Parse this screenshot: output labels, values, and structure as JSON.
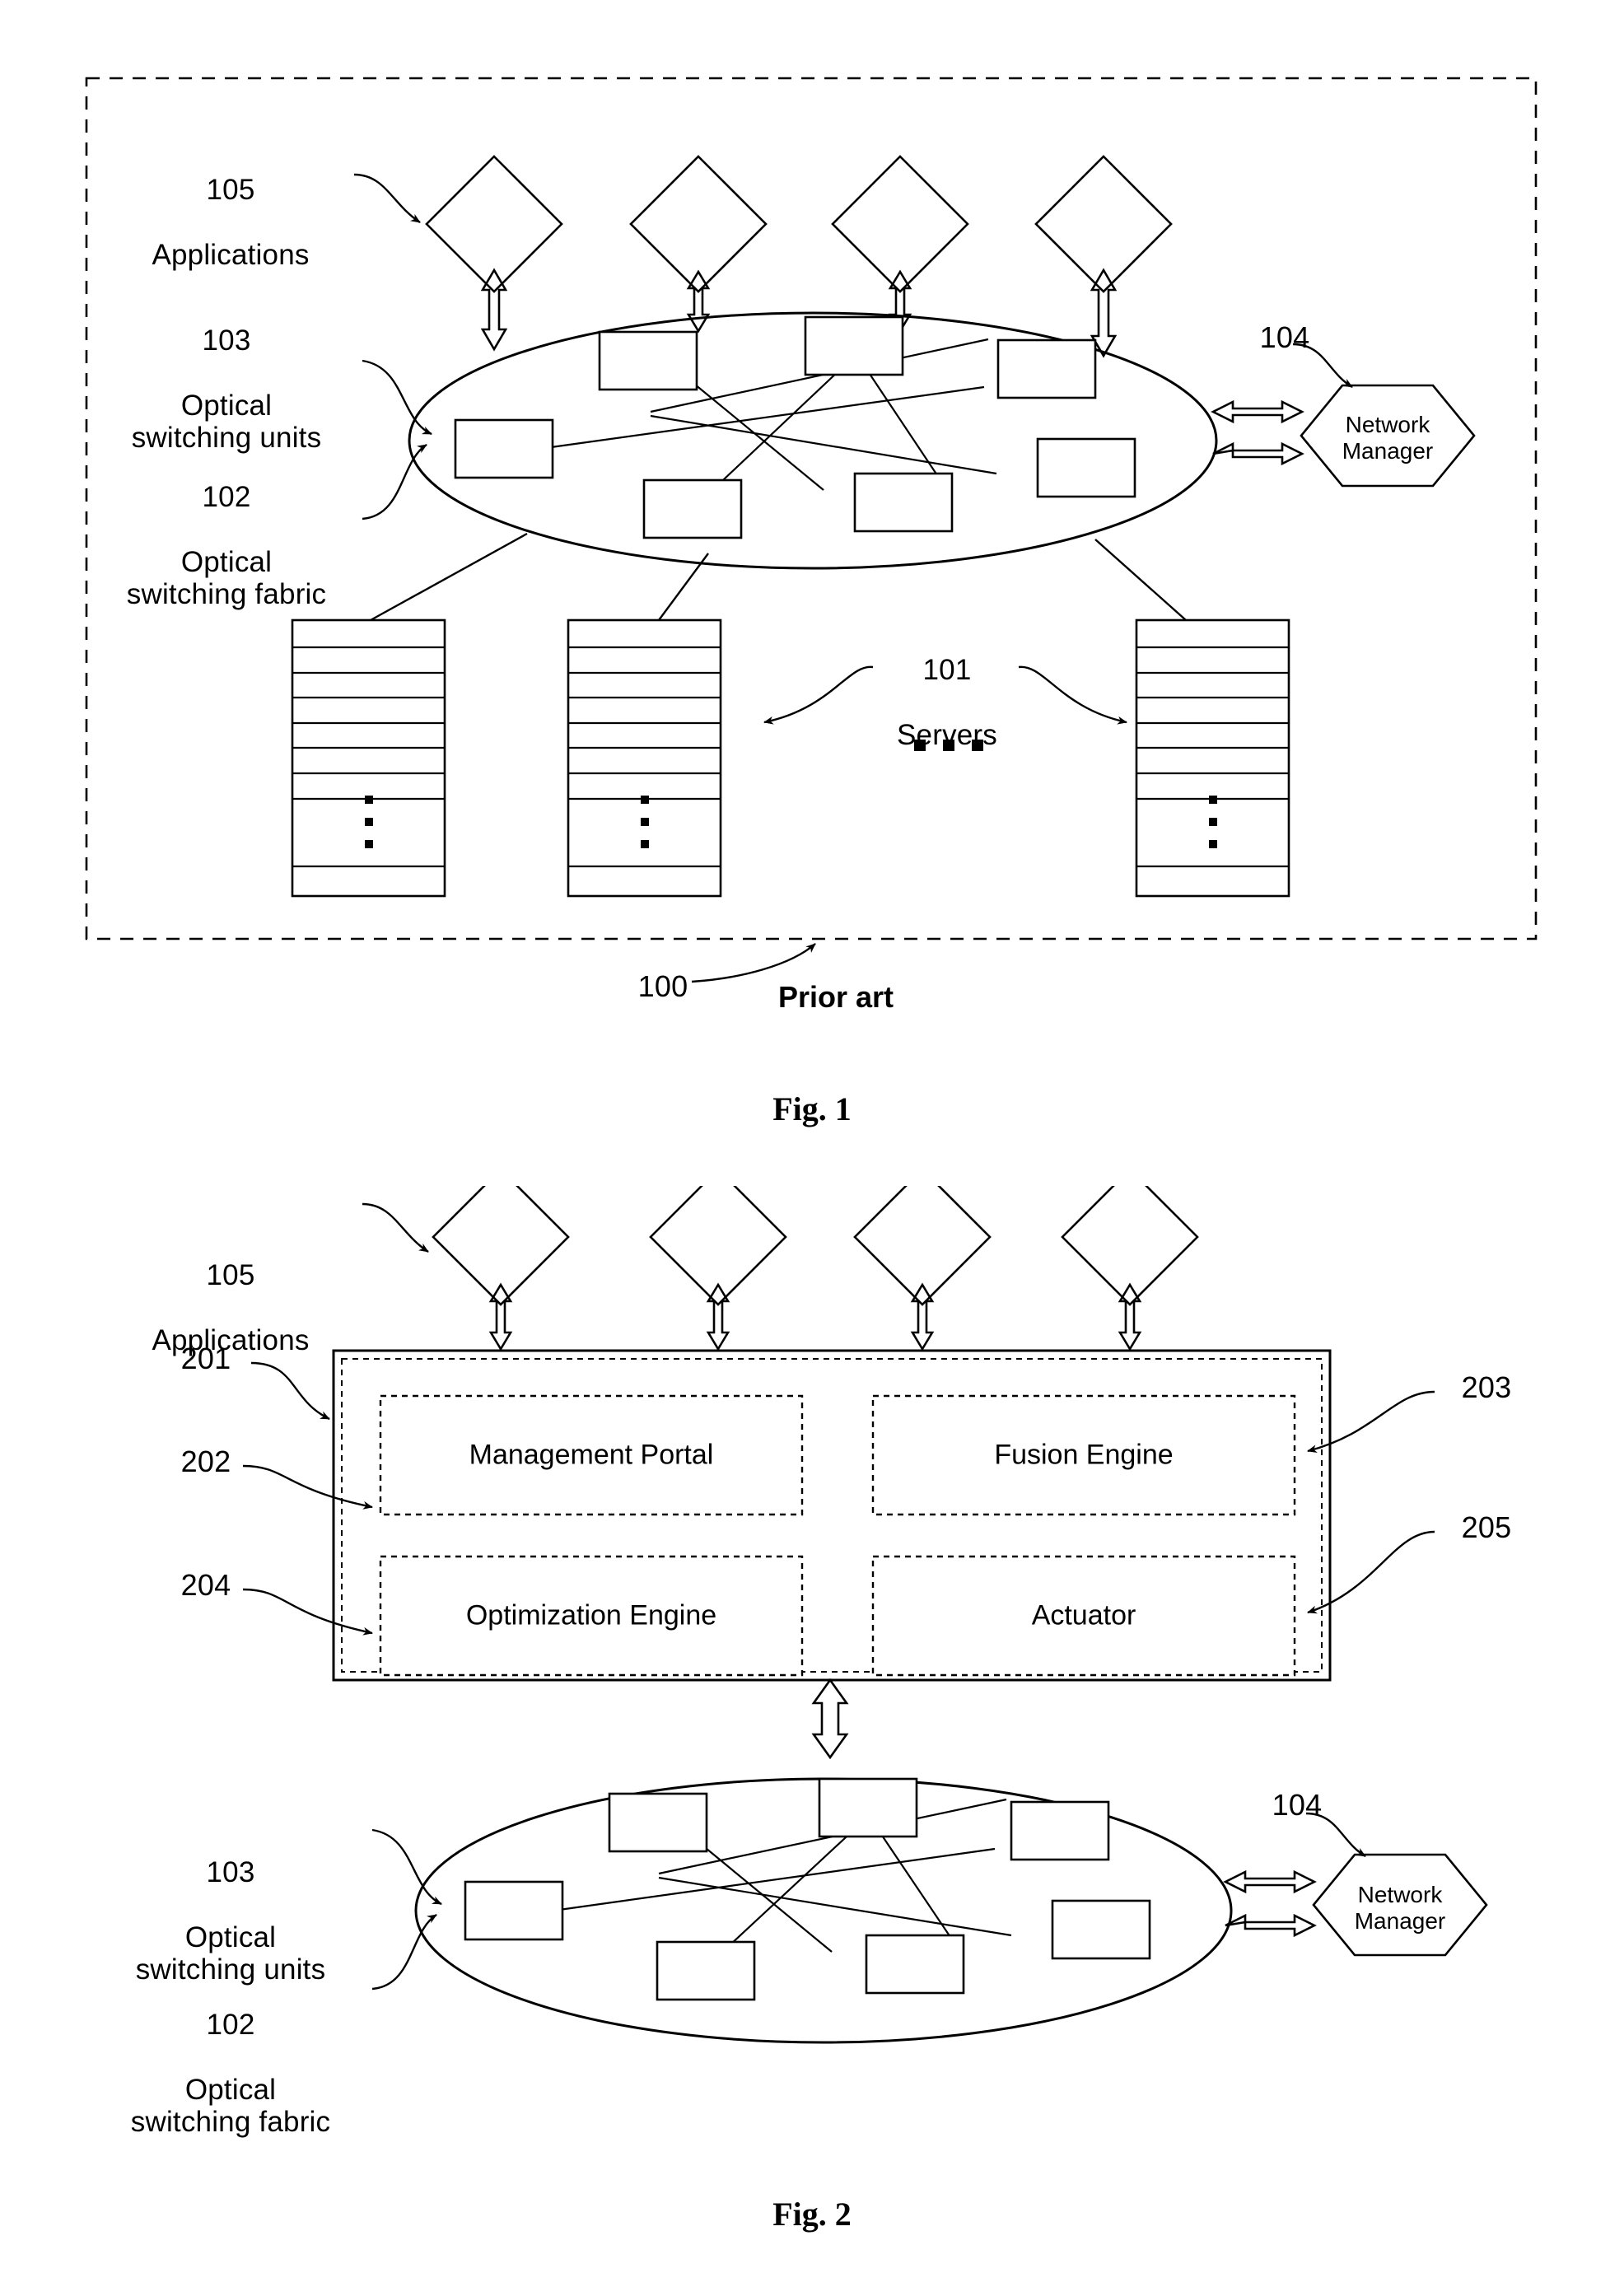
{
  "figure1": {
    "caption": "Fig. 1",
    "prior_art_note": "Prior art",
    "system_ref": "100",
    "labels": {
      "applications": {
        "number": "105",
        "text": "Applications"
      },
      "optical_switching_units": {
        "number": "103",
        "text": "Optical\nswitching units"
      },
      "optical_switching_fabric": {
        "number": "102",
        "text": "Optical\nswitching fabric"
      },
      "servers": {
        "number": "101",
        "text": "Servers"
      },
      "network_manager": {
        "number": "104",
        "text": "Network\nManager"
      }
    },
    "servers_ellipsis": "▪  ▪  ▪",
    "rack_ellipsis": "▪\n▪\n▪",
    "application_count": 4,
    "switch_unit_count": 7,
    "server_rack_count": 3
  },
  "figure2": {
    "caption": "Fig. 2",
    "labels": {
      "applications": {
        "number": "105",
        "text": "Applications"
      },
      "optical_switching_units": {
        "number": "103",
        "text": "Optical\nswitching units"
      },
      "optical_switching_fabric": {
        "number": "102",
        "text": "Optical\nswitching fabric"
      },
      "network_manager": {
        "number": "104",
        "text": "Network\nManager"
      }
    },
    "controller": {
      "ref": "201",
      "modules": [
        {
          "ref": "202",
          "name": "Management Portal"
        },
        {
          "ref": "203",
          "name": "Fusion Engine"
        },
        {
          "ref": "204",
          "name": "Optimization Engine"
        },
        {
          "ref": "205",
          "name": "Actuator"
        }
      ]
    },
    "application_count": 4,
    "switch_unit_count": 7
  },
  "colors": {
    "stroke": "#000000",
    "background": "#ffffff"
  }
}
